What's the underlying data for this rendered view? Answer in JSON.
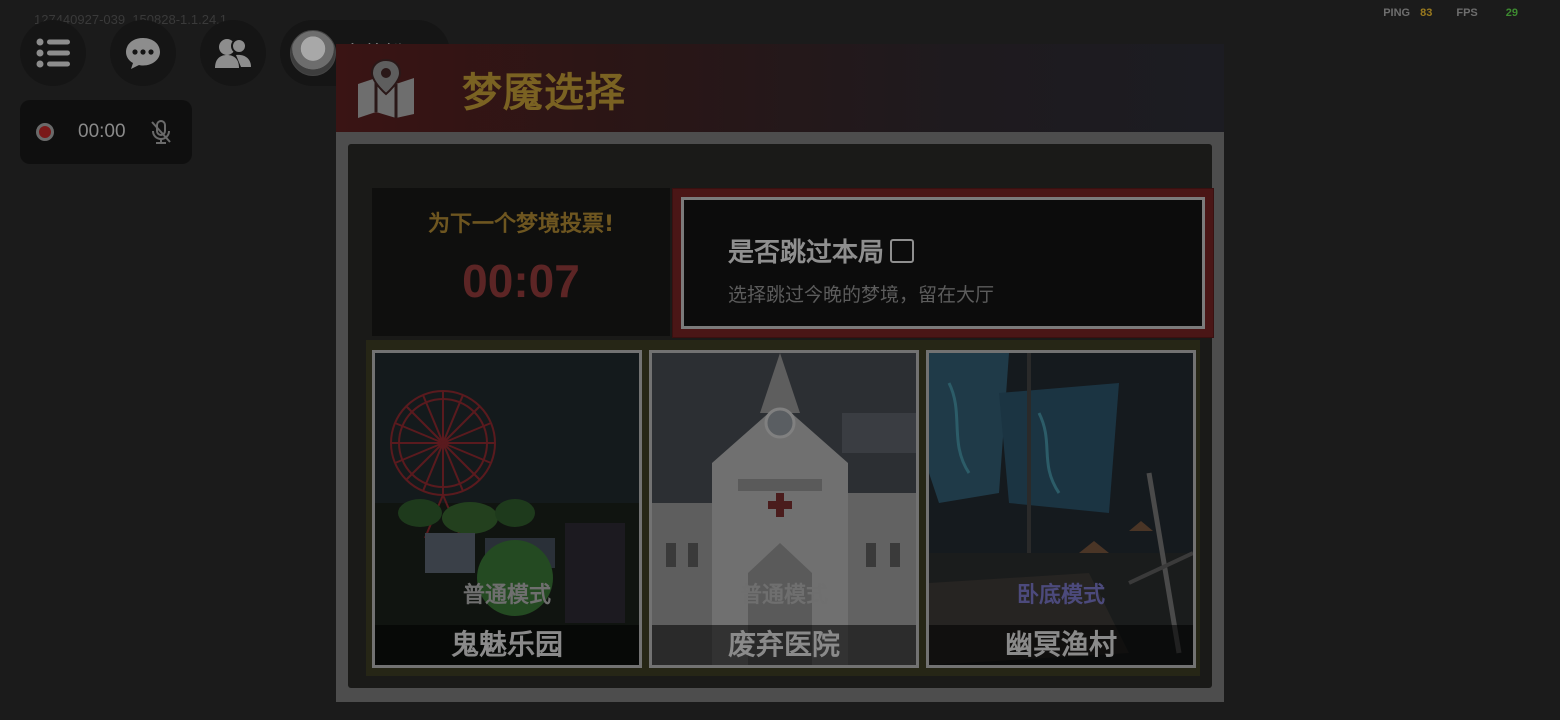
{
  "hud": {
    "build_id": "127440927-039_150828-1.1.24.1",
    "ping_label": "PING",
    "ping_value": "83",
    "fps_label": "FPS",
    "fps_value": "29"
  },
  "toolbar": {
    "menu_icon": "list-icon",
    "chat_icon": "chat-bubble-icon",
    "friends_icon": "friends-icon",
    "dress_up_label": "去装扮 >"
  },
  "recorder": {
    "time": "00:00",
    "record_icon": "record-dot-icon",
    "mic_icon": "mic-muted-icon"
  },
  "panel": {
    "title": "梦魇选择",
    "title_icon": "map-pin-icon",
    "vote_label": "为下一个梦境投票!",
    "timer": "00:07",
    "skip_title": "是否跳过本局",
    "skip_subtitle": "选择跳过今晚的梦境，留在大厅"
  },
  "maps": [
    {
      "mode": "普通模式",
      "name": "鬼魅乐园"
    },
    {
      "mode": "普通模式",
      "name": "废弃医院"
    },
    {
      "mode": "卧底模式",
      "name": "幽冥渔村"
    }
  ],
  "colors": {
    "background": "#1b1b1b",
    "title_gold": "#7a6222",
    "timer_red": "#5c2525",
    "special_mode_purple": "#4c4a7c"
  }
}
